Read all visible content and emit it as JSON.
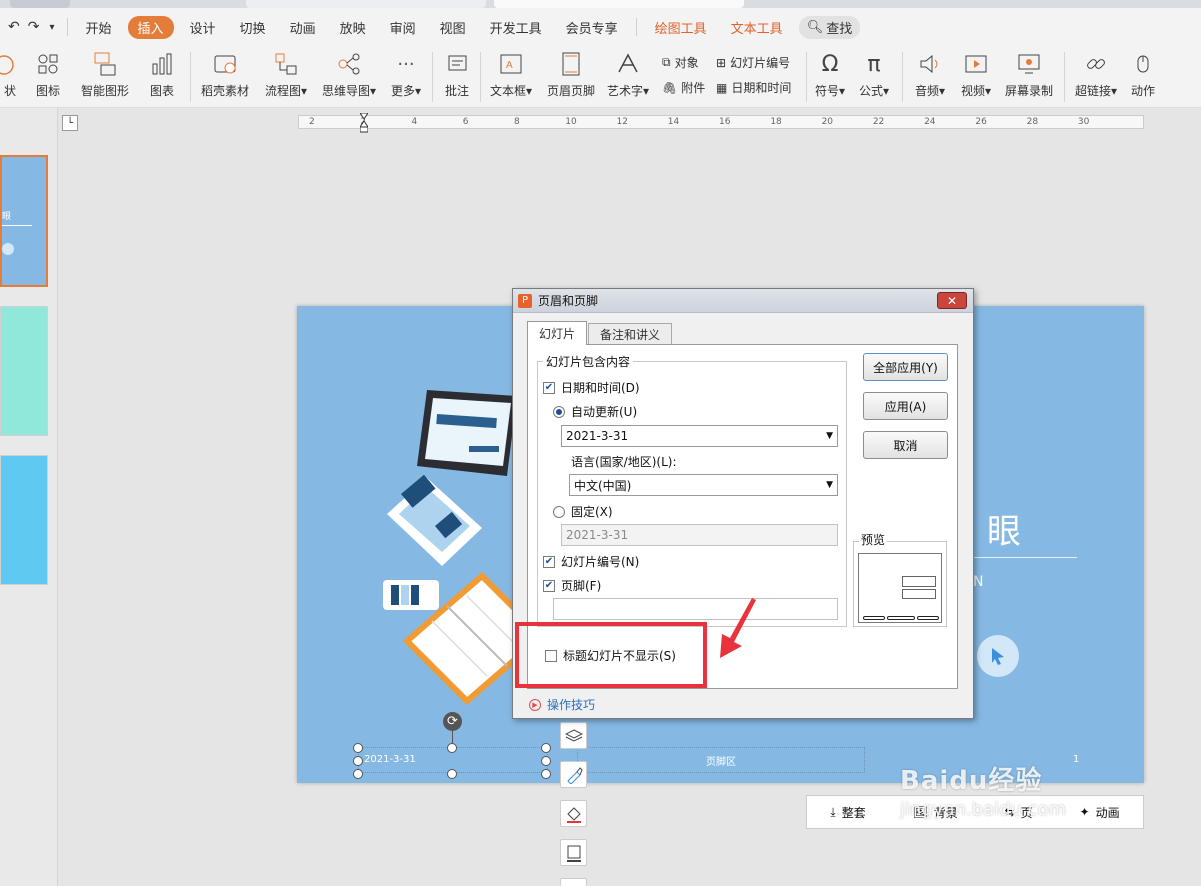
{
  "menubar": {
    "undo_icon": "undo-icon",
    "redo_icon": "redo-icon",
    "items": [
      "开始",
      "插入",
      "设计",
      "切换",
      "动画",
      "放映",
      "审阅",
      "视图",
      "开发工具",
      "会员专享"
    ],
    "active_item": "插入",
    "context_items": [
      "绘图工具",
      "文本工具"
    ],
    "search_label": "查找"
  },
  "ribbon": {
    "shape_label": "状",
    "icons_label": "图标",
    "smart_label": "智能图形",
    "chart_label": "图表",
    "material_label": "稻壳素材",
    "flow_label": "流程图",
    "mindmap_label": "思维导图",
    "more_label": "更多",
    "comment_label": "批注",
    "textbox_label": "文本框",
    "header_footer_label": "页眉页脚",
    "wordart_label": "艺术字",
    "object_label": "对象",
    "attach_label": "附件",
    "slide_number_label": "幻灯片编号",
    "datetime_label": "日期和时间",
    "symbol_label": "符号",
    "formula_label": "公式",
    "audio_label": "音频",
    "video_label": "视频",
    "screenrec_label": "屏幕录制",
    "hyperlink_label": "超链接",
    "action_label": "动作"
  },
  "ruler": {
    "ticks": [
      "2",
      "2",
      "4",
      "6",
      "8",
      "10",
      "12",
      "14",
      "16",
      "18",
      "20",
      "22",
      "24",
      "26",
      "28",
      "30"
    ]
  },
  "slide": {
    "title_fragment": "眼",
    "subtitle_fragment": "N",
    "footer_date": "2021-3-31",
    "footer_placeholder": "页脚区",
    "slide_number": "1"
  },
  "thumbnails": {
    "first_text": "眼"
  },
  "dialog": {
    "title": "页眉和页脚",
    "tabs": [
      "幻灯片",
      "备注和讲义"
    ],
    "active_tab": "幻灯片",
    "group_label": "幻灯片包含内容",
    "datetime_label": "日期和时间(D)",
    "datetime_checked": true,
    "auto_update_label": "自动更新(U)",
    "auto_update_selected": true,
    "date_value": "2021-3-31",
    "language_label": "语言(国家/地区)(L):",
    "language_value": "中文(中国)",
    "fixed_label": "固定(X)",
    "fixed_value": "2021-3-31",
    "slide_number_label": "幻灯片编号(N)",
    "slide_number_checked": true,
    "footer_label": "页脚(F)",
    "footer_checked": true,
    "footer_value": "",
    "hide_title_label": "标题幻灯片不显示(S)",
    "hide_title_checked": false,
    "preview_label": "预览",
    "apply_all_label": "全部应用(Y)",
    "apply_label": "应用(A)",
    "cancel_label": "取消",
    "tips_label": "操作技巧",
    "highlight_color": "#e8323c"
  },
  "minibar": {
    "items": [
      "整套",
      "背景",
      "页",
      "动画"
    ]
  },
  "watermark": {
    "brand": "Baidu经验",
    "url": "jingyan.baidu.com"
  },
  "colors": {
    "accent": "#e57d3a",
    "slide_bg": "#85b9e4",
    "highlight": "#e8323c"
  }
}
